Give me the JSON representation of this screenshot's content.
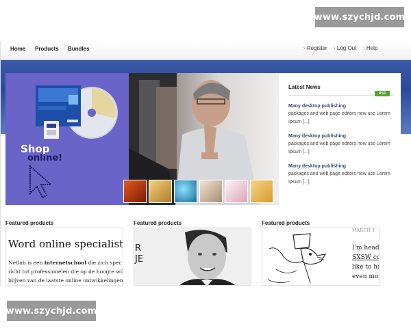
{
  "watermark": {
    "top": "www.szychjd.com",
    "bottom": "www.szychjd.com"
  },
  "nav": {
    "left": [
      "Home",
      "Products",
      "Bundles"
    ],
    "right": [
      "Register",
      "Log Out",
      "Help"
    ]
  },
  "hero": {
    "shop_line1": "Shop",
    "shop_line2": "online!"
  },
  "news": {
    "title": "Latest News",
    "rss_label": "RSS",
    "items": [
      {
        "headline": "Many desktop publishing",
        "line1": "packages and web page editors now use Lorem",
        "line2": "Ipsum [...]"
      },
      {
        "headline": "Many desktop publishing",
        "line1": "packages and web page editors now use Lorem",
        "line2": "Ipsum [...]"
      },
      {
        "headline": "Many desktop publishing",
        "line1": "packages and web page editors now use Lorem",
        "line2": "Ipsum [...]"
      }
    ]
  },
  "featured": {
    "label": "Featured products",
    "card1": {
      "title": "Word online specialist",
      "line1_pre": "Netlab is een ",
      "line1_bold": "internetschool",
      "line1_post": " die zich spec",
      "line2": "richt tot professionelen die op de hoogte wil",
      "line3": "blijven van de laatste online ontwikkelingen"
    },
    "card2": {
      "fragment1": "R",
      "fragment2": "JE"
    },
    "card3": {
      "date": "MARCH 1",
      "line1": "I'm headi",
      "line2": "SXSW co",
      "line3": "like to ha",
      "line4": "even more"
    }
  }
}
